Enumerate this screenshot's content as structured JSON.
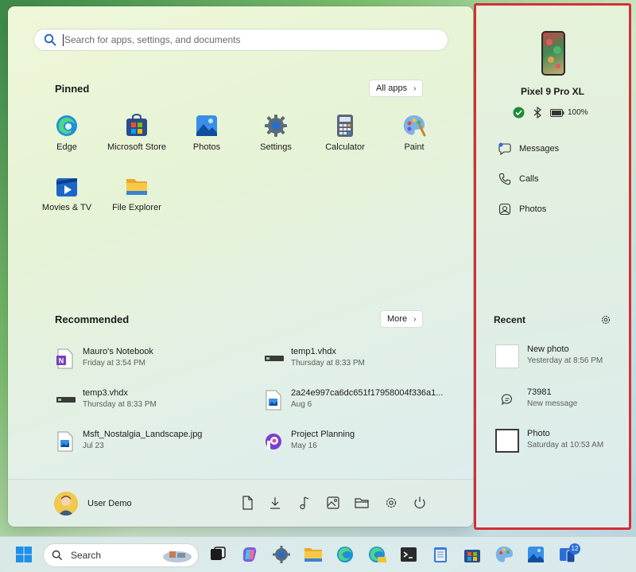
{
  "search": {
    "placeholder": "Search for apps, settings, and documents"
  },
  "pinned": {
    "title": "Pinned",
    "all_apps_label": "All apps",
    "apps": [
      {
        "label": "Edge",
        "icon": "edge-icon"
      },
      {
        "label": "Microsoft Store",
        "icon": "store-icon"
      },
      {
        "label": "Photos",
        "icon": "photos-icon"
      },
      {
        "label": "Settings",
        "icon": "settings-icon"
      },
      {
        "label": "Calculator",
        "icon": "calculator-icon"
      },
      {
        "label": "Paint",
        "icon": "paint-icon"
      },
      {
        "label": "Movies & TV",
        "icon": "movies-tv-icon"
      },
      {
        "label": "File Explorer",
        "icon": "file-explorer-icon"
      }
    ]
  },
  "recommended": {
    "title": "Recommended",
    "more_label": "More",
    "items": [
      {
        "name": "Mauro's Notebook",
        "sub": "Friday at 3:54 PM",
        "icon": "onenote-icon"
      },
      {
        "name": "temp1.vhdx",
        "sub": "Thursday at 8:33 PM",
        "icon": "vhdx-icon"
      },
      {
        "name": "temp3.vhdx",
        "sub": "Thursday at 8:33 PM",
        "icon": "vhdx-icon"
      },
      {
        "name": "2a24e997ca6dc651f17958004f336a1...",
        "sub": "Aug 6",
        "icon": "image-file-icon"
      },
      {
        "name": "Msft_Nostalgia_Landscape.jpg",
        "sub": "Jul 23",
        "icon": "image-file-icon"
      },
      {
        "name": "Project Planning",
        "sub": "May 16",
        "icon": "loop-icon"
      }
    ]
  },
  "footer": {
    "user_name": "User Demo"
  },
  "phone": {
    "device_name": "Pixel 9 Pro XL",
    "battery": "100%",
    "links": [
      {
        "label": "Messages",
        "icon": "messages-icon"
      },
      {
        "label": "Calls",
        "icon": "calls-icon"
      },
      {
        "label": "Photos",
        "icon": "phone-photos-icon"
      }
    ],
    "recent_title": "Recent",
    "recent": [
      {
        "title": "New photo",
        "sub": "Yesterday at 8:56 PM",
        "icon": "photo-thumb"
      },
      {
        "title": "73981",
        "sub": "New message",
        "icon": "message-icon"
      },
      {
        "title": "Photo",
        "sub": "Saturday at 10:53 AM",
        "icon": "photo-thumb"
      }
    ],
    "border_color": "#d42f36"
  },
  "taskbar": {
    "search_label": "Search",
    "badge_count": "12"
  }
}
